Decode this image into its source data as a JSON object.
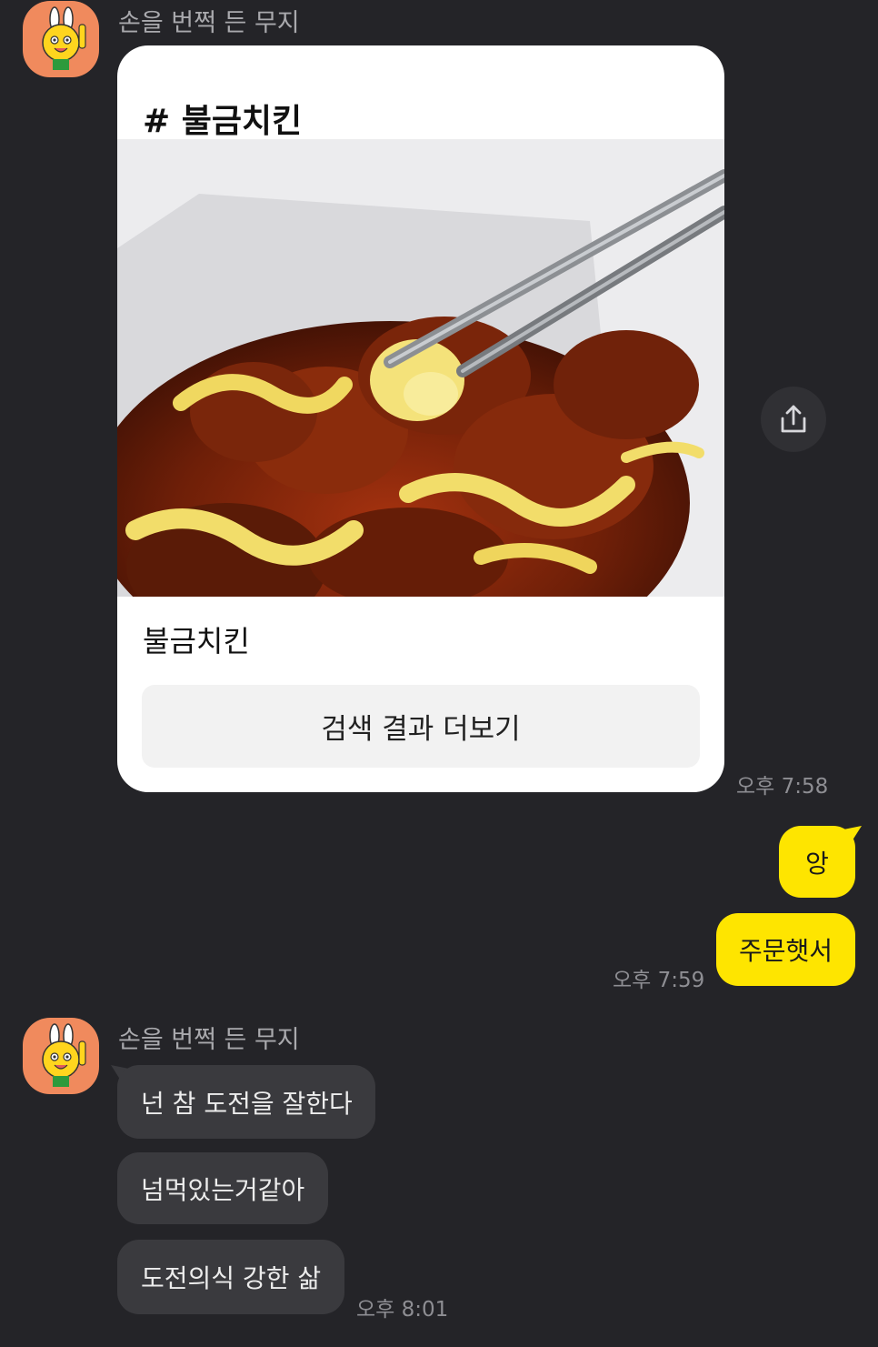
{
  "colors": {
    "background": "#242428",
    "outgoing_bubble": "#fee500",
    "incoming_bubble": "#3a3a3e",
    "avatar_bg": "#f08a5d"
  },
  "messages": {
    "group1": {
      "sender": "손을 번쩍 든 무지",
      "card": {
        "hashtag": "# 불금치킨",
        "caption": "불금치킨",
        "button_label": "검색 결과 더보기"
      },
      "share_icon": "share-icon",
      "time": "오후 7:58"
    },
    "outgoing": {
      "bubbles": [
        "앙",
        "주문햇서"
      ],
      "time": "오후 7:59"
    },
    "group2": {
      "sender": "손을 번쩍 든 무지",
      "bubbles": [
        "넌 참 도전을 잘한다",
        "넘먹있는거같아",
        "도전의식 강한 삶"
      ],
      "time": "오후 8:01"
    }
  }
}
